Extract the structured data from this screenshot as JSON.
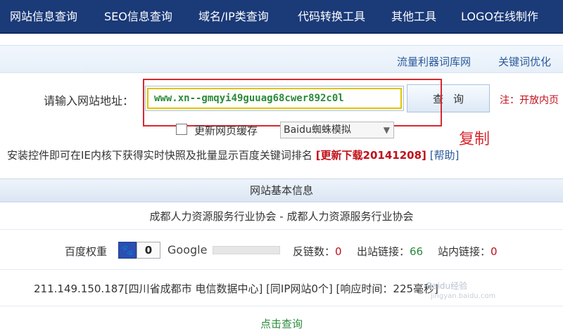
{
  "nav": {
    "items": [
      {
        "label": "网站信息查询"
      },
      {
        "label": "SEO信息查询"
      },
      {
        "label": "域名/IP类查询"
      },
      {
        "label": "代码转换工具"
      },
      {
        "label": "其他工具"
      },
      {
        "label": "LOGO在线制作"
      }
    ]
  },
  "subbar": {
    "links": [
      {
        "label": "流量利器词库网"
      },
      {
        "label": "关键词优化"
      }
    ]
  },
  "query": {
    "label": "请输入网站地址：",
    "url_value": "www.xn--gmqyi49guuag68cwer892c0l",
    "button_label": "查询",
    "note": "注：开放内页"
  },
  "options": {
    "cache_label": "更新网页缓存",
    "cache_checked": false,
    "ua_selected": "Baidu蜘蛛模拟"
  },
  "annotation": {
    "copy": "复制"
  },
  "install": {
    "text": "安装控件即可在IE内核下获得实时快照及批量显示百度关键词排名",
    "update_link": "[更新下载20141208]",
    "help_link": "[帮助]"
  },
  "info": {
    "section_title": "网站基本信息",
    "site_title": "成都人力资源服务行业协会 - 成都人力资源服务行业协会",
    "baidu_weight_label": "百度权重",
    "baidu_weight_value": "0",
    "google_label": "Google",
    "backlinks_label": "反链数：",
    "backlinks_value": "0",
    "outlinks_label": "出站链接：",
    "outlinks_value": "66",
    "inlinks_label": "站内链接：",
    "inlinks_value": "0",
    "ip_line": "211.149.150.187[四川省成都市 电信数据中心]  [同IP网站0个]  [响应时间：225毫秒]",
    "click_query": "点击查询"
  },
  "watermark": {
    "text": "Baidu经验",
    "sub": "jingyan.baidu.com"
  },
  "colors": {
    "nav_bg": "#1a3a78",
    "highlight_red": "#d8282f",
    "link_blue": "#2a5a9a",
    "value_green": "#2a8a3a",
    "value_red": "#c0101a"
  }
}
